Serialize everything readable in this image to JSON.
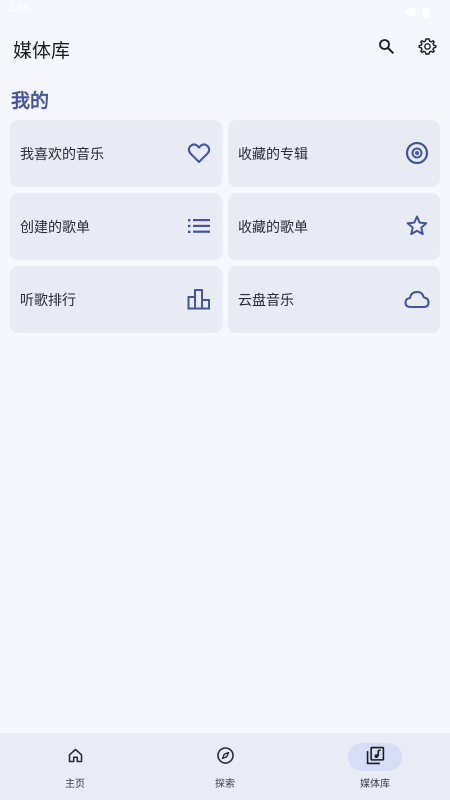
{
  "status_bar": {
    "time": "2:46"
  },
  "header": {
    "title": "媒体库",
    "search_icon": "search-icon",
    "settings_icon": "gear-icon"
  },
  "section": {
    "title": "我的"
  },
  "cards": [
    {
      "label": "我喜欢的音乐",
      "icon": "heart-icon"
    },
    {
      "label": "收藏的专辑",
      "icon": "album-icon"
    },
    {
      "label": "创建的歌单",
      "icon": "list-icon"
    },
    {
      "label": "收藏的歌单",
      "icon": "star-icon"
    },
    {
      "label": "听歌排行",
      "icon": "chart-icon"
    },
    {
      "label": "云盘音乐",
      "icon": "cloud-icon"
    }
  ],
  "bottom_nav": {
    "items": [
      {
        "label": "主页",
        "icon": "home-icon",
        "active": false
      },
      {
        "label": "探索",
        "icon": "compass-icon",
        "active": false
      },
      {
        "label": "媒体库",
        "icon": "library-music-icon",
        "active": true
      }
    ]
  },
  "colors": {
    "accent": "#44569a",
    "background": "#f6f7fd",
    "card": "#e8eaf4",
    "active_pill": "#d7dcf7"
  }
}
